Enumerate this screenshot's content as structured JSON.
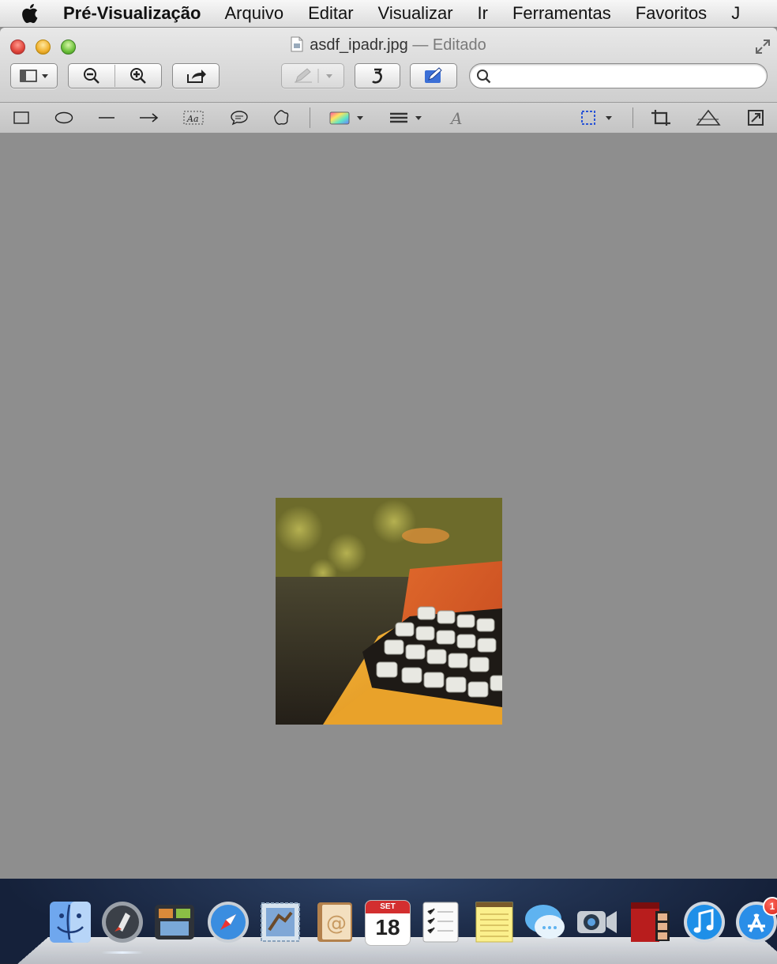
{
  "menubar": {
    "app_name": "Pré-Visualização",
    "items": [
      "Arquivo",
      "Editar",
      "Visualizar",
      "Ir",
      "Ferramentas",
      "Favoritos",
      "J"
    ]
  },
  "window": {
    "filename": "asdf_ipadr.jpg",
    "status": " — Editado"
  },
  "toolbar": {
    "search_value": ""
  },
  "dock": {
    "calendar_month": "SET",
    "calendar_day": "18",
    "app_store_badge": "1"
  },
  "colors": {
    "canvas_bg": "#8e8e8e",
    "markup_accent": "#3b6fd6"
  }
}
